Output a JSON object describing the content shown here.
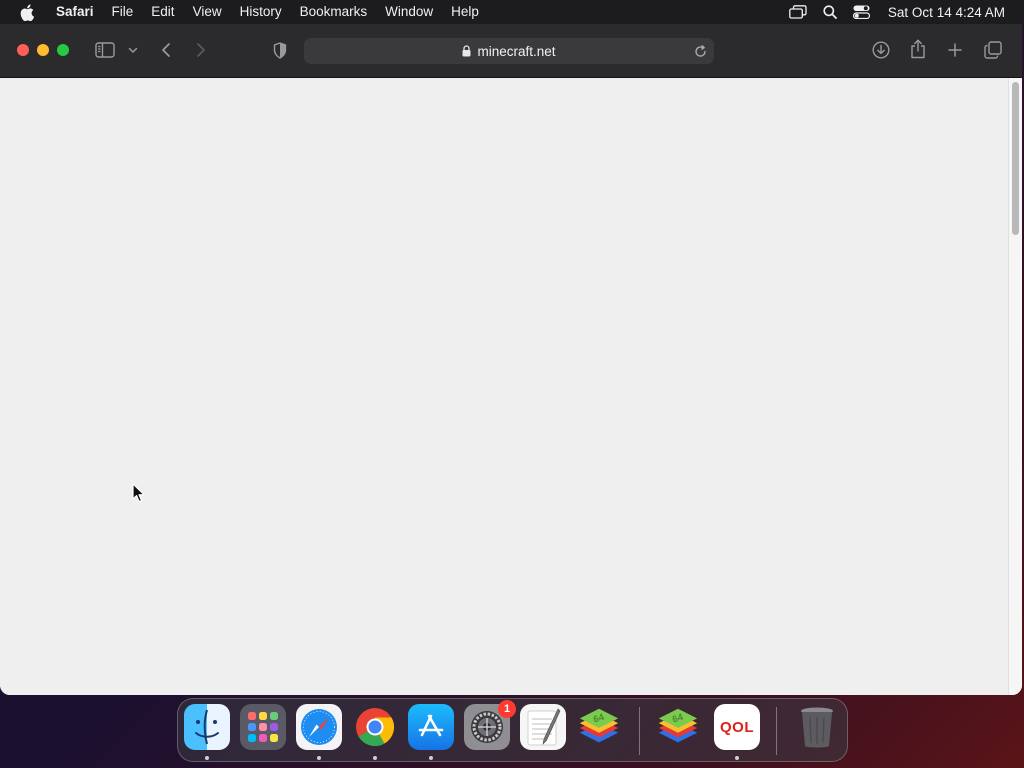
{
  "menubar": {
    "apple_icon": "apple-logo-icon",
    "app_name": "Safari",
    "items": [
      "File",
      "Edit",
      "View",
      "History",
      "Bookmarks",
      "Window",
      "Help"
    ],
    "status_icons": [
      "screen-mirroring-icon",
      "spotlight-search-icon",
      "control-center-icon"
    ],
    "clock": "Sat Oct 14  4:24 AM"
  },
  "browser": {
    "toolbar_icons": [
      "sidebar-icon",
      "chevron-down-icon",
      "back-icon",
      "forward-icon",
      "privacy-shield-icon",
      "download-icon",
      "share-icon",
      "new-tab-icon",
      "tab-overview-icon"
    ],
    "url": "minecraft.net",
    "page_state": "blank"
  },
  "dock": {
    "apps": [
      "Finder",
      "Launchpad",
      "Safari",
      "Google Chrome",
      "App Store",
      "System Settings",
      "TextEdit",
      "BlueStacks",
      "BlueStacks",
      "QOL",
      "Trash"
    ],
    "system_settings_badge": "1",
    "qol_label": "QOL"
  },
  "colors": {
    "menubar_bg": "#1c1c1e",
    "toolbar_bg": "#2b2b2d",
    "content_bg": "#efefef",
    "close": "#ff5f57",
    "minimize": "#febc2e",
    "maximize": "#28c840"
  }
}
